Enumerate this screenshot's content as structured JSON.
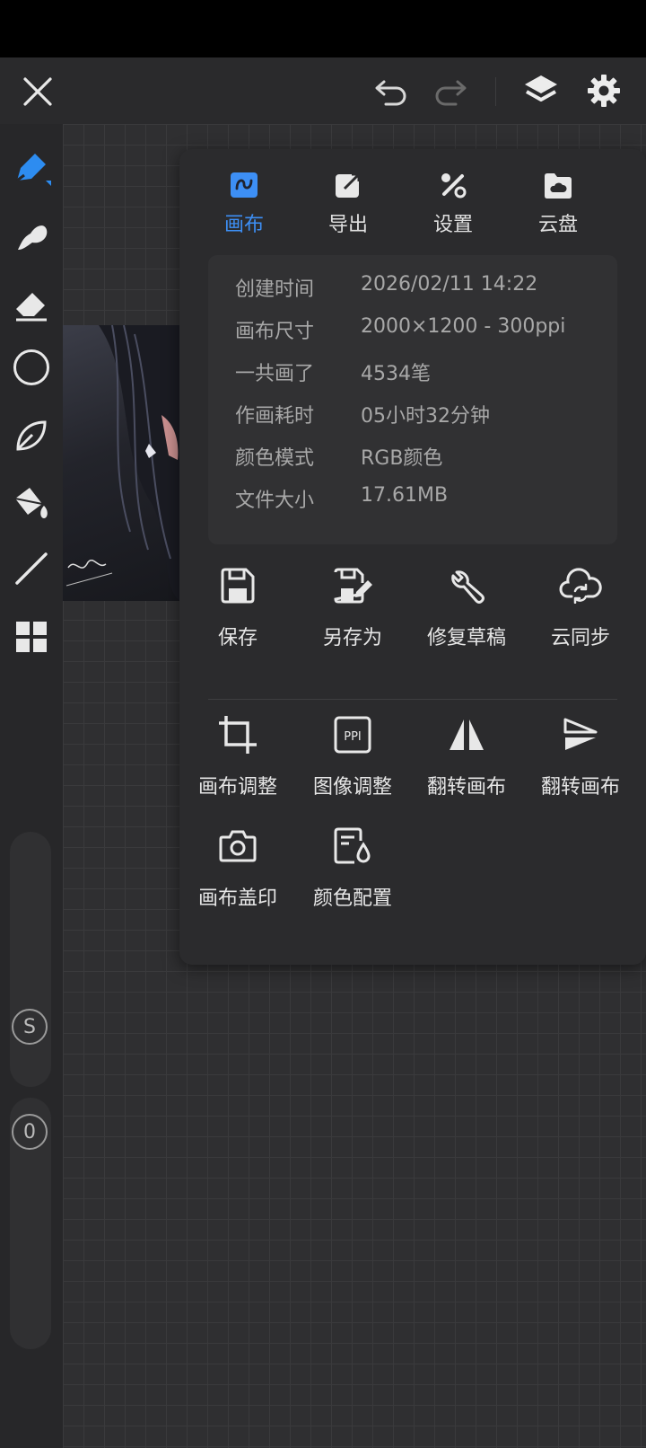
{
  "toolbar": {
    "close_icon": "close-icon",
    "undo_icon": "undo-icon",
    "redo_icon": "redo-icon",
    "layers_icon": "layers-icon",
    "settings_icon": "gear-icon"
  },
  "tools": [
    "pen-icon",
    "smudge-icon",
    "eraser-icon",
    "color-circle-icon",
    "leaf-brush-icon",
    "fill-bucket-icon",
    "line-icon",
    "grid-icon"
  ],
  "sliders": {
    "size_label": "S",
    "opacity_label": "0"
  },
  "tabs": [
    {
      "label": "画布",
      "icon": "canvas-icon",
      "active": true
    },
    {
      "label": "导出",
      "icon": "export-icon",
      "active": false
    },
    {
      "label": "设置",
      "icon": "tools-icon",
      "active": false
    },
    {
      "label": "云盘",
      "icon": "cloud-folder-icon",
      "active": false
    }
  ],
  "info": [
    {
      "key": "创建时间",
      "value": "2026/02/11 14:22"
    },
    {
      "key": "画布尺寸",
      "value": "2000×1200 - 300ppi"
    },
    {
      "key": "一共画了",
      "value": "4534笔"
    },
    {
      "key": "作画耗时",
      "value": "05小时32分钟"
    },
    {
      "key": "颜色模式",
      "value": "RGB颜色"
    },
    {
      "key": "文件大小",
      "value": "17.61MB"
    }
  ],
  "actions_row1": [
    {
      "label": "保存",
      "icon": "save-icon"
    },
    {
      "label": "另存为",
      "icon": "save-as-icon"
    },
    {
      "label": "修复草稿",
      "icon": "wrench-icon"
    },
    {
      "label": "云同步",
      "icon": "cloud-sync-icon"
    }
  ],
  "actions_row2": [
    {
      "label": "画布调整",
      "icon": "crop-icon"
    },
    {
      "label": "图像调整",
      "icon": "ppi-icon"
    },
    {
      "label": "翻转画布",
      "icon": "flip-horizontal-icon"
    },
    {
      "label": "翻转画布",
      "icon": "flip-vertical-icon"
    }
  ],
  "actions_row3": [
    {
      "label": "画布盖印",
      "icon": "camera-icon"
    },
    {
      "label": "颜色配置",
      "icon": "color-profile-icon"
    }
  ],
  "colors": {
    "accent": "#3d8ff5",
    "panel": "#2b2b2d",
    "toolbar": "#2a2a2c"
  }
}
